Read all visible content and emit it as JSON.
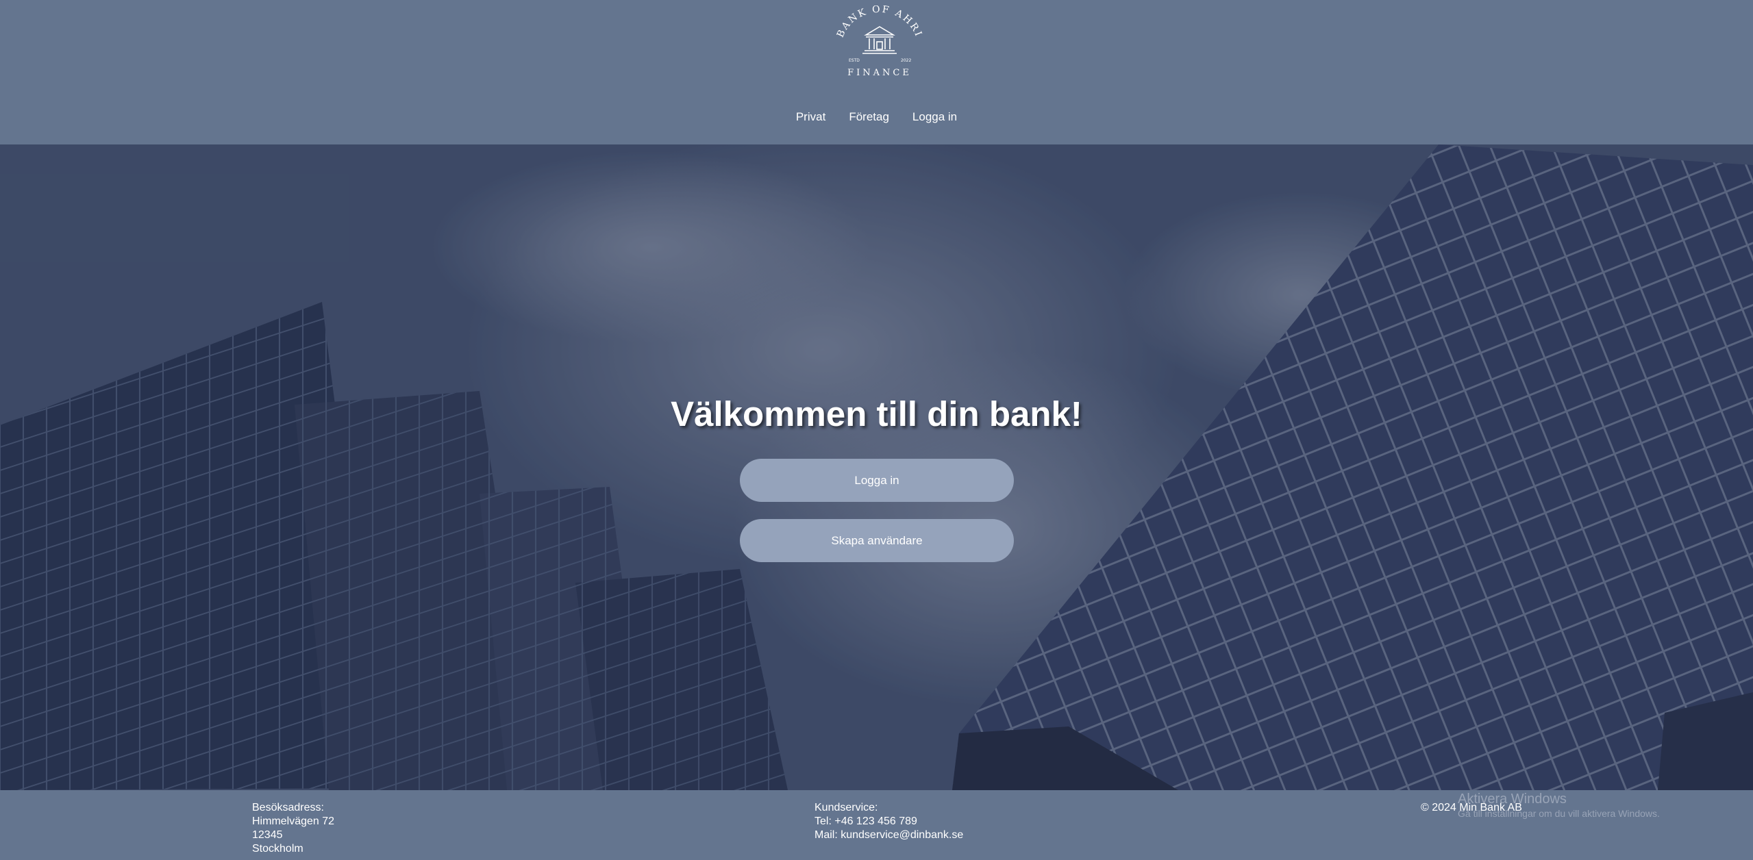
{
  "header": {
    "logo": {
      "top_text": "BANK OF AHRI",
      "bottom_text": "FINANCE",
      "estd_label": "ESTD",
      "year": "2022"
    },
    "nav": [
      {
        "label": "Privat"
      },
      {
        "label": "Företag"
      },
      {
        "label": "Logga in"
      }
    ]
  },
  "hero": {
    "title": "Välkommen till din bank!",
    "login_button": "Logga in",
    "create_user_button": "Skapa användare"
  },
  "footer": {
    "address": {
      "heading": "Besöksadress:",
      "street": "Himmelvägen 72",
      "zip": "12345",
      "city": "Stockholm"
    },
    "service": {
      "heading": "Kundservice:",
      "phone": "Tel: +46 123 456 789",
      "mail": "Mail: kundservice@dinbank.se"
    },
    "copyright": "© 2024 Min Bank AB"
  },
  "os_watermark": {
    "title": "Aktivera Windows",
    "subtitle": "Gå till inställningar om du vill aktivera Windows."
  },
  "colors": {
    "header_bg": "#64758f",
    "button_bg": "#95a3bb",
    "text": "#ffffff"
  }
}
